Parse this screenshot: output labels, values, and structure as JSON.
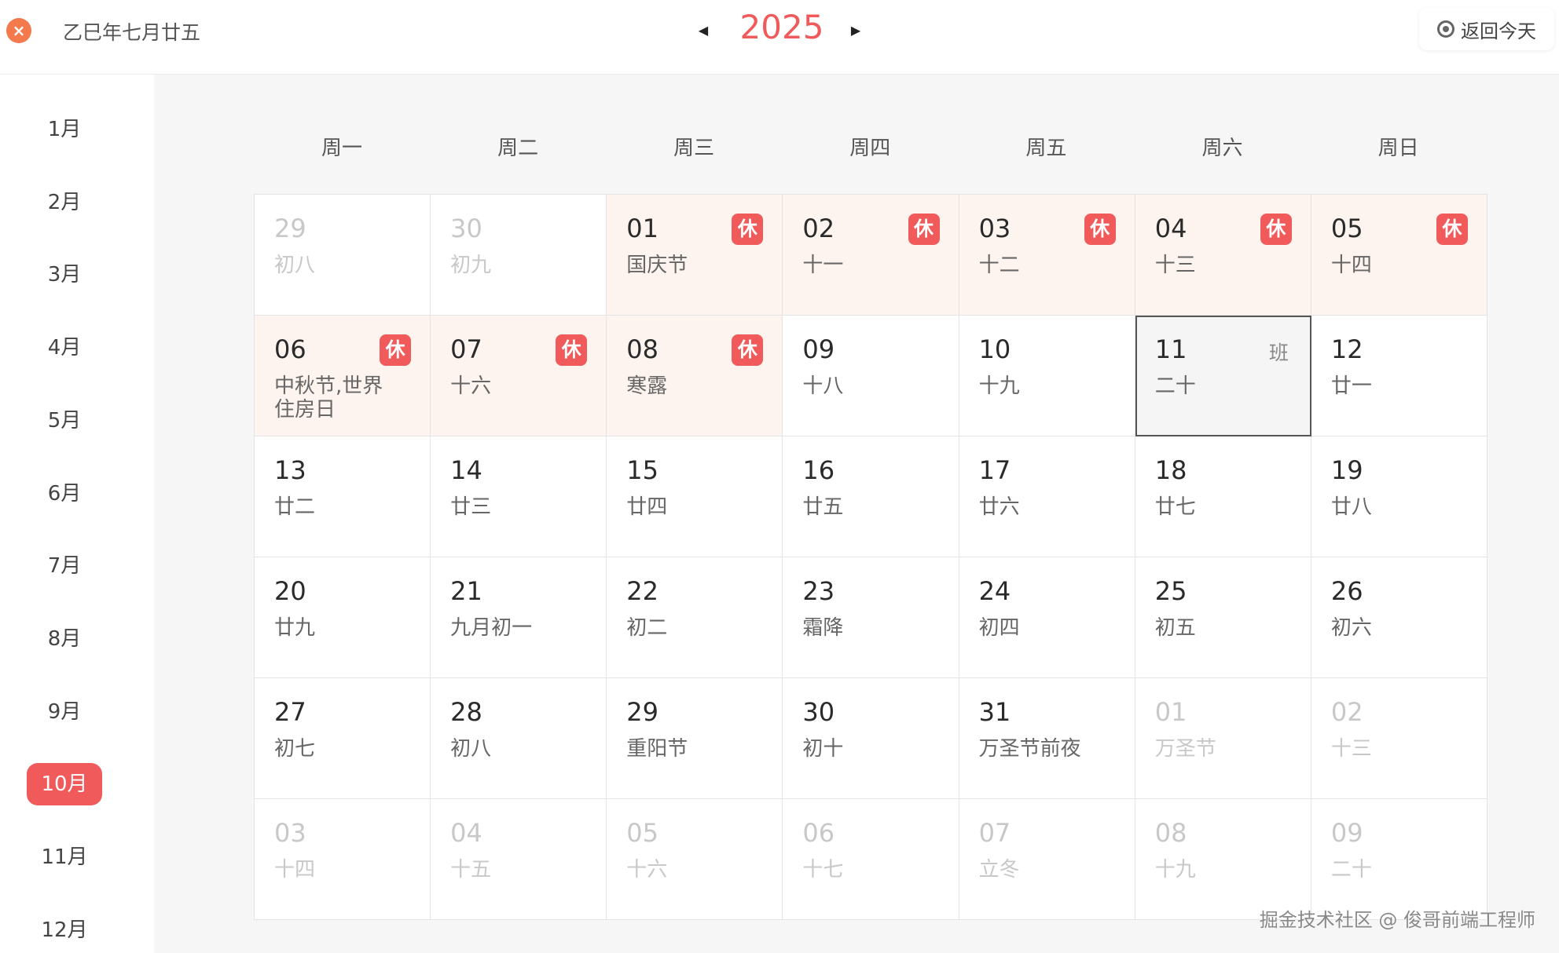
{
  "header": {
    "lunar_date": "乙巳年七月廿五",
    "year": "2025",
    "today_label": "返回今天",
    "close_symbol": "×",
    "prev_symbol": "◀",
    "next_symbol": "▶"
  },
  "sidebar": {
    "months": [
      "1月",
      "2月",
      "3月",
      "4月",
      "5月",
      "6月",
      "7月",
      "8月",
      "9月",
      "10月",
      "11月",
      "12月"
    ],
    "active": "10月"
  },
  "weekdays": [
    "周一",
    "周二",
    "周三",
    "周四",
    "周五",
    "周六",
    "周日"
  ],
  "days": [
    {
      "day": "29",
      "lunar": "初八",
      "muted": true
    },
    {
      "day": "30",
      "lunar": "初九",
      "muted": true
    },
    {
      "day": "01",
      "lunar": "国庆节",
      "badge": "休",
      "holiday": true
    },
    {
      "day": "02",
      "lunar": "十一",
      "badge": "休",
      "holiday": true
    },
    {
      "day": "03",
      "lunar": "十二",
      "badge": "休",
      "holiday": true
    },
    {
      "day": "04",
      "lunar": "十三",
      "badge": "休",
      "holiday": true
    },
    {
      "day": "05",
      "lunar": "十四",
      "badge": "休",
      "holiday": true
    },
    {
      "day": "06",
      "lunar": "中秋节,世界住房日",
      "badge": "休",
      "holiday": true
    },
    {
      "day": "07",
      "lunar": "十六",
      "badge": "休",
      "holiday": true
    },
    {
      "day": "08",
      "lunar": "寒露",
      "badge": "休",
      "holiday": true
    },
    {
      "day": "09",
      "lunar": "十八"
    },
    {
      "day": "10",
      "lunar": "十九"
    },
    {
      "day": "11",
      "lunar": "二十",
      "work": "班",
      "selected": true
    },
    {
      "day": "12",
      "lunar": "廿一"
    },
    {
      "day": "13",
      "lunar": "廿二"
    },
    {
      "day": "14",
      "lunar": "廿三"
    },
    {
      "day": "15",
      "lunar": "廿四"
    },
    {
      "day": "16",
      "lunar": "廿五"
    },
    {
      "day": "17",
      "lunar": "廿六"
    },
    {
      "day": "18",
      "lunar": "廿七"
    },
    {
      "day": "19",
      "lunar": "廿八"
    },
    {
      "day": "20",
      "lunar": "廿九"
    },
    {
      "day": "21",
      "lunar": "九月初一"
    },
    {
      "day": "22",
      "lunar": "初二"
    },
    {
      "day": "23",
      "lunar": "霜降"
    },
    {
      "day": "24",
      "lunar": "初四"
    },
    {
      "day": "25",
      "lunar": "初五"
    },
    {
      "day": "26",
      "lunar": "初六"
    },
    {
      "day": "27",
      "lunar": "初七"
    },
    {
      "day": "28",
      "lunar": "初八"
    },
    {
      "day": "29",
      "lunar": "重阳节"
    },
    {
      "day": "30",
      "lunar": "初十"
    },
    {
      "day": "31",
      "lunar": "万圣节前夜"
    },
    {
      "day": "01",
      "lunar": "万圣节",
      "muted": true
    },
    {
      "day": "02",
      "lunar": "十三",
      "muted": true
    },
    {
      "day": "03",
      "lunar": "十四",
      "muted": true
    },
    {
      "day": "04",
      "lunar": "十五",
      "muted": true
    },
    {
      "day": "05",
      "lunar": "十六",
      "muted": true
    },
    {
      "day": "06",
      "lunar": "十七",
      "muted": true
    },
    {
      "day": "07",
      "lunar": "立冬",
      "muted": true
    },
    {
      "day": "08",
      "lunar": "十九",
      "muted": true
    },
    {
      "day": "09",
      "lunar": "二十",
      "muted": true
    }
  ],
  "watermark": "掘金技术社区 @ 俊哥前端工程师",
  "colors": {
    "accent": "#f05a5a",
    "holiday_bg": "#fdf4ef",
    "close_btn": "#f27a4d"
  }
}
